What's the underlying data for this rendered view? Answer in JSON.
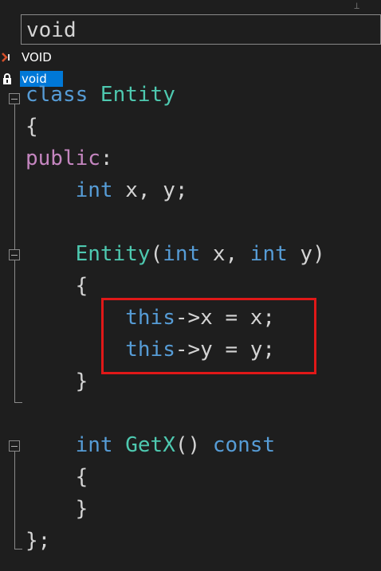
{
  "search": {
    "value": "void"
  },
  "autocomplete": {
    "items": [
      {
        "label": "VOID",
        "icon": "macro-icon",
        "selected": false
      },
      {
        "label": "void",
        "icon": "keyword-lock-icon",
        "selected": true
      }
    ]
  },
  "code": {
    "lines": [
      {
        "tokens": [
          [
            "cl",
            "class "
          ],
          [
            "ty",
            "Entity"
          ]
        ]
      },
      {
        "tokens": [
          [
            "pl",
            "{"
          ]
        ]
      },
      {
        "tokens": [
          [
            "kw",
            "public"
          ],
          [
            "pl",
            ":"
          ]
        ]
      },
      {
        "tokens": [
          [
            "pl",
            "    "
          ],
          [
            "kb",
            "int"
          ],
          [
            "pl",
            " x, y;"
          ]
        ]
      },
      {
        "tokens": [
          [
            "pl",
            ""
          ]
        ]
      },
      {
        "tokens": [
          [
            "pl",
            "    "
          ],
          [
            "ty",
            "Entity"
          ],
          [
            "pl",
            "("
          ],
          [
            "kb",
            "int"
          ],
          [
            "pl",
            " x, "
          ],
          [
            "kb",
            "int"
          ],
          [
            "pl",
            " y)"
          ]
        ]
      },
      {
        "tokens": [
          [
            "pl",
            "    {"
          ]
        ]
      },
      {
        "tokens": [
          [
            "pl",
            "        "
          ],
          [
            "kb",
            "this"
          ],
          [
            "pl",
            "->x = x;"
          ]
        ]
      },
      {
        "tokens": [
          [
            "pl",
            "        "
          ],
          [
            "kb",
            "this"
          ],
          [
            "pl",
            "->y = y;"
          ]
        ]
      },
      {
        "tokens": [
          [
            "pl",
            "    }"
          ]
        ]
      },
      {
        "tokens": [
          [
            "pl",
            ""
          ]
        ]
      },
      {
        "tokens": [
          [
            "pl",
            "    "
          ],
          [
            "kb",
            "int"
          ],
          [
            "pl",
            " "
          ],
          [
            "ty",
            "GetX"
          ],
          [
            "pl",
            "() "
          ],
          [
            "kb",
            "const"
          ]
        ]
      },
      {
        "tokens": [
          [
            "pl",
            "    {"
          ]
        ]
      },
      {
        "tokens": [
          [
            "pl",
            "    }"
          ]
        ]
      },
      {
        "tokens": [
          [
            "pl",
            "};"
          ]
        ]
      }
    ]
  },
  "colors": {
    "keyword": "#c586c0",
    "keyword_blue": "#569cd6",
    "type": "#4ec9b0",
    "text": "#d4d4d4",
    "highlight_border": "#e01818",
    "selection": "#0078d7"
  }
}
